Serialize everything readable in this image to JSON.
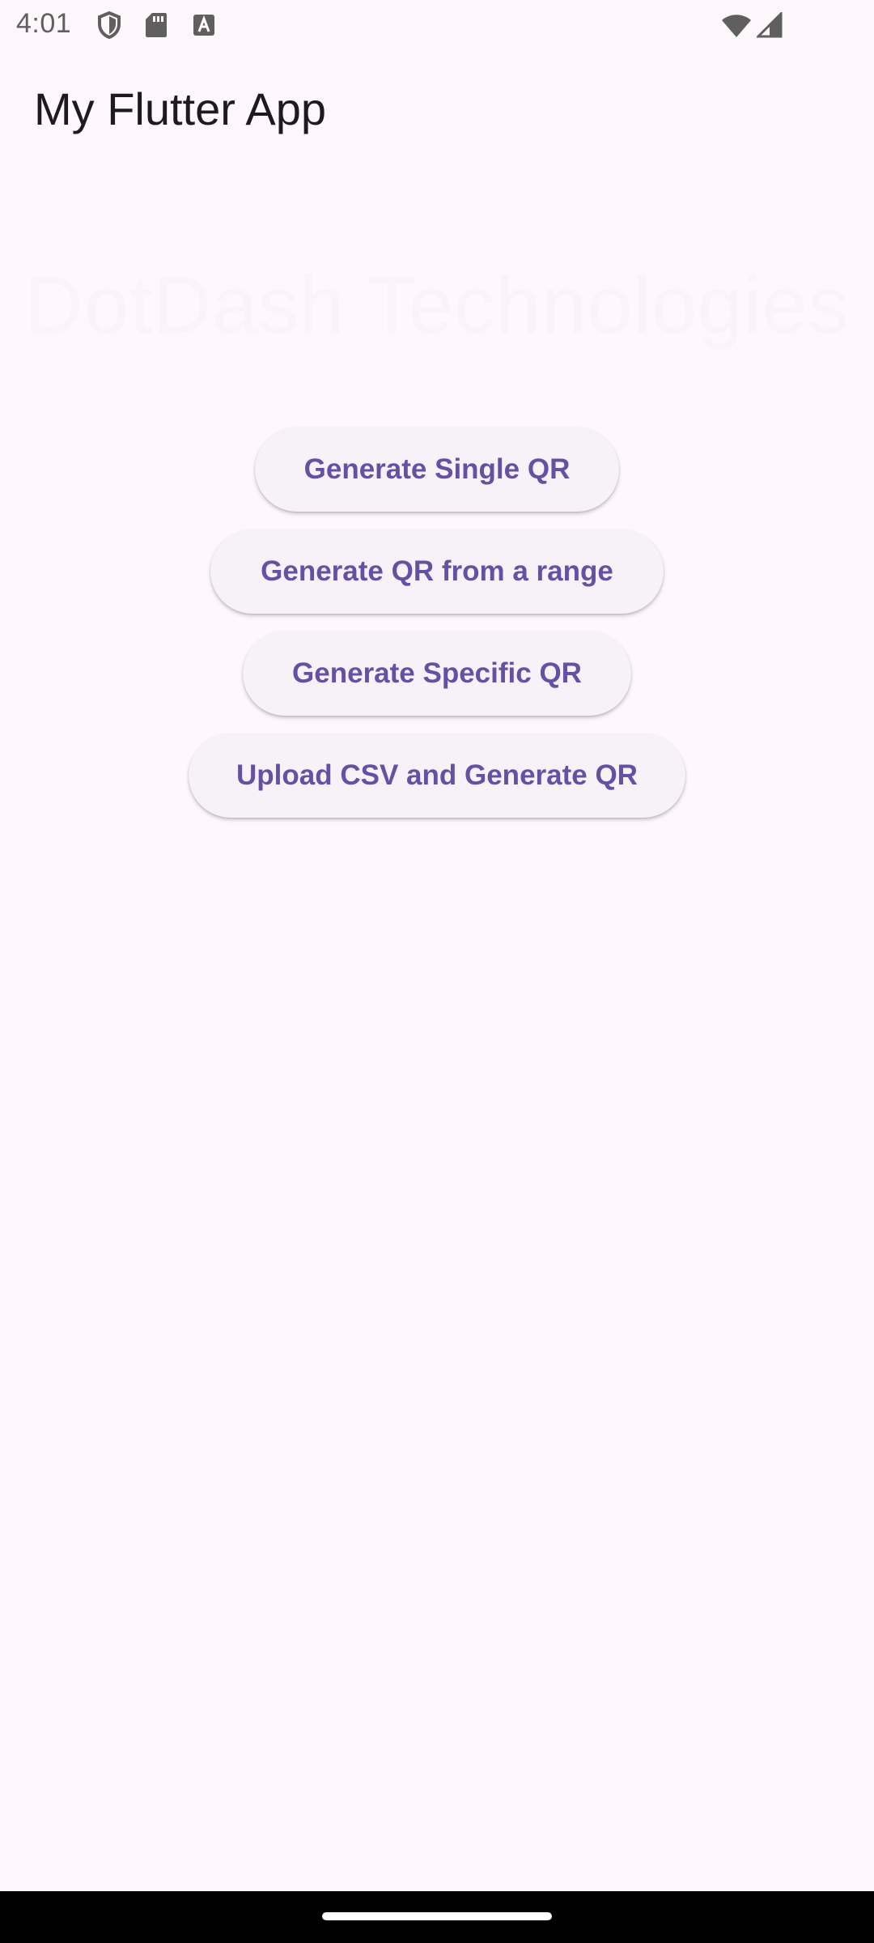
{
  "status_bar": {
    "time": "4:01",
    "icons": [
      "shield-icon",
      "sd-card-icon",
      "font-a-icon",
      "wifi-icon",
      "cell-signal-icon"
    ]
  },
  "app_bar": {
    "title": "My Flutter App"
  },
  "watermark": {
    "text": "DotDash Technologies"
  },
  "buttons": {
    "single": "Generate Single QR",
    "range": "Generate QR from a range",
    "specific": "Generate Specific QR",
    "csv": "Upload CSV and Generate QR"
  },
  "colors": {
    "background": "#fef7fc",
    "button_bg": "#f7f1f8",
    "button_text": "#6750a4",
    "watermark": "#fcf2f9",
    "nav_bar": "#000000"
  }
}
